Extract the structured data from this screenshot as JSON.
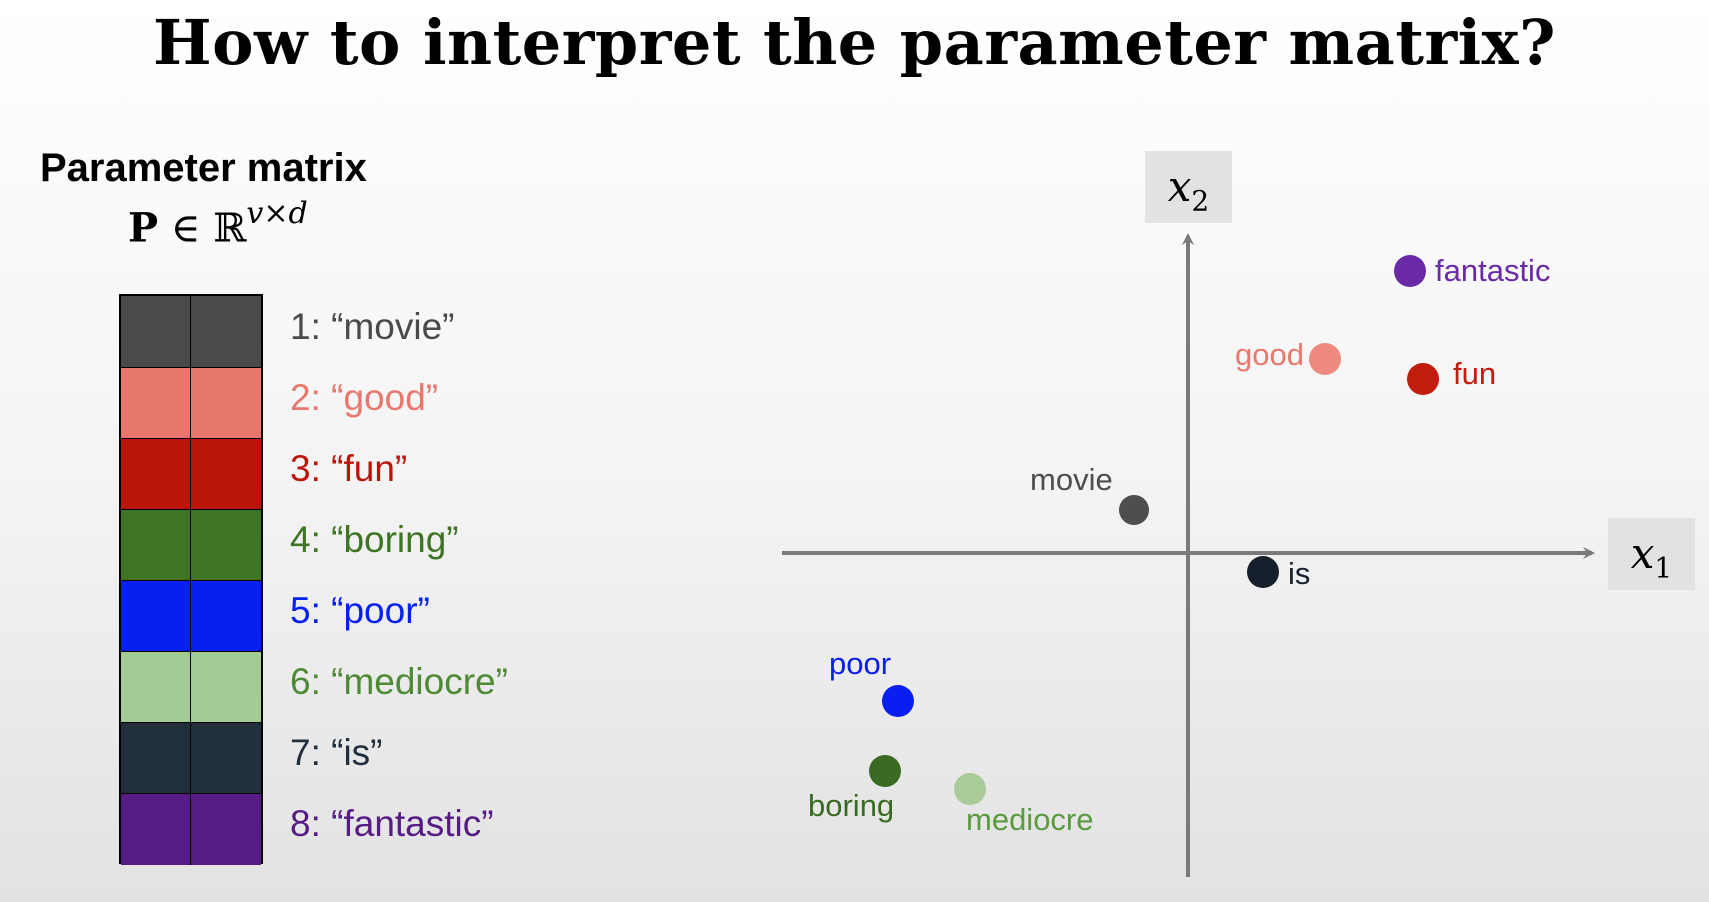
{
  "title": "How to interpret the parameter matrix?",
  "matrix_section": {
    "heading": "Parameter matrix",
    "formula": {
      "symbol": "P",
      "relation": "∈",
      "space": "ℝ",
      "superscript": "v×d"
    },
    "rows": [
      {
        "label": "1: “movie”",
        "color": "#4a4a4a",
        "label_color": "#4a4a4a"
      },
      {
        "label": "2: “good”",
        "color": "#e8786e",
        "label_color": "#e8786e"
      },
      {
        "label": "3: “fun”",
        "color": "#bb1408",
        "label_color": "#bb1408"
      },
      {
        "label": "4: “boring”",
        "color": "#3f7424",
        "label_color": "#3f7424"
      },
      {
        "label": "5: “poor”",
        "color": "#0620f0",
        "label_color": "#0620f0"
      },
      {
        "label": "6: “mediocre”",
        "color": "#a3cb94",
        "label_color": "#4f8a35"
      },
      {
        "label": "7: “is”",
        "color": "#222f3d",
        "label_color": "#222f3d"
      },
      {
        "label": "8: “fantastic”",
        "color": "#571b86",
        "label_color": "#571b86"
      }
    ]
  },
  "embedding_plot": {
    "x_axis_label": "x",
    "x_axis_subscript": "1",
    "y_axis_label": "x",
    "y_axis_subscript": "2",
    "axis_color": "#7a7a7a",
    "points": [
      {
        "word": "fantastic",
        "color": "#6a2aa8",
        "label_color": "#6a2aa8"
      },
      {
        "word": "good",
        "color": "#ee8a80",
        "label_color": "#e8786e"
      },
      {
        "word": "fun",
        "color": "#c21c0e",
        "label_color": "#c21c0e"
      },
      {
        "word": "movie",
        "color": "#4e4e4e",
        "label_color": "#4e4e4e"
      },
      {
        "word": "is",
        "color": "#16202c",
        "label_color": "#16202c"
      },
      {
        "word": "poor",
        "color": "#0a1ef2",
        "label_color": "#0a1ef2"
      },
      {
        "word": "boring",
        "color": "#3a6b22",
        "label_color": "#3a6b22"
      },
      {
        "word": "mediocre",
        "color": "#a8cb98",
        "label_color": "#5a9a40"
      }
    ]
  }
}
